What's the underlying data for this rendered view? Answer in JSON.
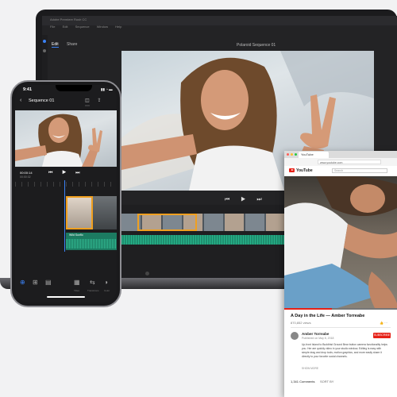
{
  "laptop": {
    "app_title": "Adobe Premiere Rush CC",
    "menu": [
      "File",
      "Edit",
      "Sequence",
      "Window",
      "Help"
    ],
    "tabs": [
      {
        "label": "Edit",
        "active": true
      },
      {
        "label": "Share",
        "active": false
      }
    ],
    "sequence_title": "Polaroid Sequence 01",
    "playback_controls": "⏮ ▶ ⏭"
  },
  "browser": {
    "tab_title": "YouTube",
    "url": "www.youtube.com",
    "site_name": "YouTube",
    "search_placeholder": "Search",
    "video_title": "A Day in the Life — Amber Torreabe",
    "views": "870,852 views",
    "likes": "👍 ···",
    "channel_name": "Amber Torreabe",
    "published": "Published on May 8, 2018",
    "subscribe_label": "SUBSCRIBE",
    "description": "Up-front Island to Buddhist Ground Bear button camera functionality helps you. Her are quickly video in your studio window, Editing is easy with simple drag and drop tools, motion graphics, and more easily share it directly to your favorite social channels.",
    "show_more": "SHOW MORE",
    "comments_count": "1,341 Comments",
    "sort_by": "SORT BY",
    "accent_color": "#e62117"
  },
  "phone": {
    "time": "9:41",
    "status": "▮▮ ◔ ▬",
    "back_glyph": "‹",
    "sequence_title": "Sequence 01",
    "header_icons": "◫ ⇪ ⋯",
    "timecode": "00:00:14",
    "timecode_total": "00:00:32",
    "playback_controls": "⏮ ▶ ⏭",
    "audio_track_label": "Wild Sunflo",
    "toolbar": [
      {
        "glyph": "⊕",
        "label": ""
      },
      {
        "glyph": "⊞",
        "label": ""
      },
      {
        "glyph": "▤",
        "label": ""
      },
      {
        "glyph": "▦",
        "label": "Titles"
      },
      {
        "glyph": "⇆",
        "label": "Transitions"
      },
      {
        "glyph": "◑",
        "label": "Color"
      }
    ],
    "accent_color": "#3b82f6"
  }
}
